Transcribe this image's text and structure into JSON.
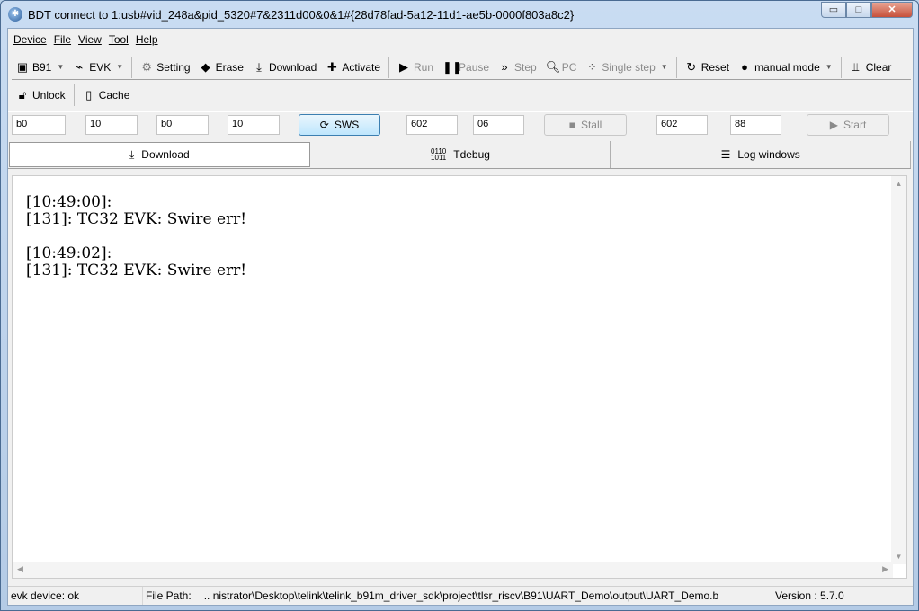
{
  "window": {
    "title": "BDT connect to 1:usb#vid_248a&pid_5320#7&2311d00&0&1#{28d78fad-5a12-11d1-ae5b-0000f803a8c2}",
    "minimize": "▭",
    "maximize": "□",
    "close": "✕"
  },
  "menu": [
    "Device",
    "File",
    "View",
    "Tool",
    "Help"
  ],
  "toolbar": {
    "chip": "B91",
    "board": "EVK",
    "setting": "Setting",
    "erase": "Erase",
    "download": "Download",
    "activate": "Activate",
    "run": "Run",
    "pause": "Pause",
    "step": "Step",
    "pc": "PC",
    "single_step": "Single step",
    "reset": "Reset",
    "mode": "manual mode",
    "clear": "Clear"
  },
  "toolbar2": {
    "unlock": "Unlock",
    "cache": "Cache"
  },
  "fields": {
    "f1": "b0",
    "f2": "10",
    "f3": "b0",
    "f4": "10",
    "sws": "SWS",
    "f5": "602",
    "f6": "06",
    "stall": "Stall",
    "f7": "602",
    "f8": "88",
    "start": "Start"
  },
  "tabs": [
    "Download",
    "Tdebug",
    "Log windows"
  ],
  "log": "[10:49:00]:\n[131]: TC32 EVK: Swire err!\n\n[10:49:02]:\n[131]: TC32 EVK: Swire err!",
  "status": {
    "device": "evk device: ok",
    "path_label": "File Path:",
    "path": "..  nistrator\\Desktop\\telink\\telink_b91m_driver_sdk\\project\\tlsr_riscv\\B91\\UART_Demo\\output\\UART_Demo.b",
    "version": "Version : 5.7.0"
  }
}
